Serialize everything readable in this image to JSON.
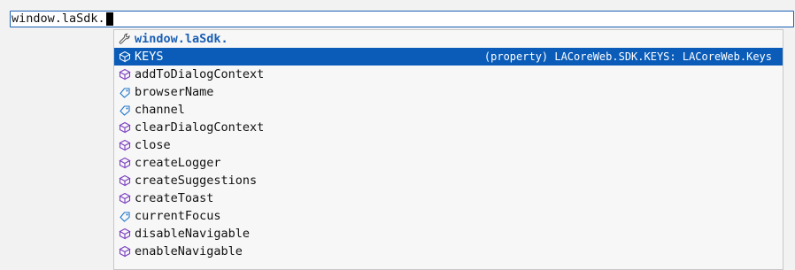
{
  "editor": {
    "text": "window.laSdk."
  },
  "suggest": {
    "header_label": "window.laSdk.",
    "header_icon": "wrench-icon",
    "selected": {
      "label": "KEYS",
      "detail": "(property) LACoreWeb.SDK.KEYS: LACoreWeb.Keys",
      "icon": "property-icon"
    },
    "items": [
      {
        "label": "addToDialogContext",
        "icon": "method-icon"
      },
      {
        "label": "browserName",
        "icon": "property-icon"
      },
      {
        "label": "channel",
        "icon": "property-icon"
      },
      {
        "label": "clearDialogContext",
        "icon": "method-icon"
      },
      {
        "label": "close",
        "icon": "method-icon"
      },
      {
        "label": "createLogger",
        "icon": "method-icon"
      },
      {
        "label": "createSuggestions",
        "icon": "method-icon"
      },
      {
        "label": "createToast",
        "icon": "method-icon"
      },
      {
        "label": "currentFocus",
        "icon": "property-icon"
      },
      {
        "label": "disableNavigable",
        "icon": "method-icon"
      },
      {
        "label": "enableNavigable",
        "icon": "method-icon"
      }
    ]
  },
  "colors": {
    "selection": "#0a5cb8",
    "method_icon": "#7b3fbf",
    "property_icon": "#1f77c9",
    "header_text": "#1a5fb4"
  }
}
